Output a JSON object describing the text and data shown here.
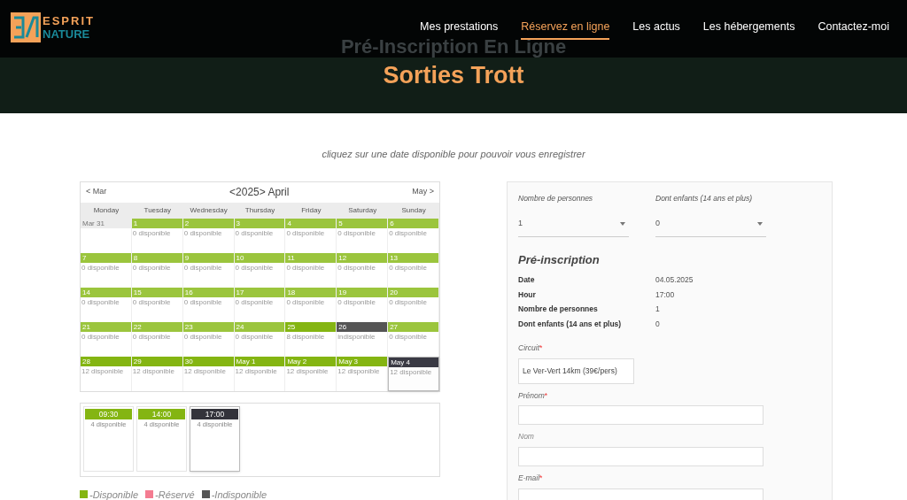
{
  "header": {
    "logo": {
      "line1": "ESPRIT",
      "line2": "NATURE"
    },
    "nav": [
      {
        "label": "Mes prestations",
        "selected": false
      },
      {
        "label": "Réservez en ligne",
        "selected": true
      },
      {
        "label": "Les actus",
        "selected": false
      },
      {
        "label": "Les hébergements",
        "selected": false
      },
      {
        "label": "Contactez-moi",
        "selected": false
      }
    ]
  },
  "hero": {
    "title": "Pré-Inscription En Ligne",
    "subtitle": "Sorties Trott"
  },
  "instruction": "cliquez sur une date disponible pour pouvoir vous enregistrer",
  "calendar": {
    "prev": "< Mar",
    "title": "<2025> April",
    "next": "May >",
    "weekdays": [
      "Monday",
      "Tuesday",
      "Wednesday",
      "Thursday",
      "Friday",
      "Saturday",
      "Sunday"
    ],
    "weeks": [
      [
        {
          "day": "Mar 31",
          "color": "#ececec",
          "selected": false
        },
        {
          "day": "1",
          "info": "0 disponible",
          "color": "#9bc53d",
          "selected": false
        },
        {
          "day": "2",
          "info": "0 disponible",
          "color": "#9bc53d",
          "selected": false
        },
        {
          "day": "3",
          "info": "0 disponible",
          "color": "#9bc53d",
          "selected": false
        },
        {
          "day": "4",
          "info": "0 disponible",
          "color": "#9bc53d",
          "selected": false
        },
        {
          "day": "5",
          "info": "0 disponible",
          "color": "#9bc53d",
          "selected": false
        },
        {
          "day": "6",
          "info": "0 disponible",
          "color": "#9bc53d",
          "selected": false
        }
      ],
      [
        {
          "day": "7",
          "info": "0 disponible",
          "color": "#9bc53d",
          "selected": false
        },
        {
          "day": "8",
          "info": "0 disponible",
          "color": "#9bc53d",
          "selected": false
        },
        {
          "day": "9",
          "info": "0 disponible",
          "color": "#9bc53d",
          "selected": false
        },
        {
          "day": "10",
          "info": "0 disponible",
          "color": "#9bc53d",
          "selected": false
        },
        {
          "day": "11",
          "info": "0 disponible",
          "color": "#9bc53d",
          "selected": false
        },
        {
          "day": "12",
          "info": "0 disponible",
          "color": "#9bc53d",
          "selected": false
        },
        {
          "day": "13",
          "info": "0 disponible",
          "color": "#9bc53d",
          "selected": false
        }
      ],
      [
        {
          "day": "14",
          "info": "0 disponible",
          "color": "#9bc53d",
          "selected": false
        },
        {
          "day": "15",
          "info": "0 disponible",
          "color": "#9bc53d",
          "selected": false
        },
        {
          "day": "16",
          "info": "0 disponible",
          "color": "#9bc53d",
          "selected": false
        },
        {
          "day": "17",
          "info": "0 disponible",
          "color": "#9bc53d",
          "selected": false
        },
        {
          "day": "18",
          "info": "0 disponible",
          "color": "#9bc53d",
          "selected": false
        },
        {
          "day": "19",
          "info": "0 disponible",
          "color": "#9bc53d",
          "selected": false
        },
        {
          "day": "20",
          "info": "0 disponible",
          "color": "#9bc53d",
          "selected": false
        }
      ],
      [
        {
          "day": "21",
          "info": "0 disponible",
          "color": "#9bc53d",
          "selected": false
        },
        {
          "day": "22",
          "info": "0 disponible",
          "color": "#9bc53d",
          "selected": false
        },
        {
          "day": "23",
          "info": "0 disponible",
          "color": "#9bc53d",
          "selected": false
        },
        {
          "day": "24",
          "info": "0 disponible",
          "color": "#9bc53d",
          "selected": false
        },
        {
          "day": "25",
          "info": "8 disponible",
          "color": "#84b512",
          "selected": false
        },
        {
          "day": "26",
          "info": "indisponible",
          "color": "#555555",
          "selected": false
        },
        {
          "day": "27",
          "info": "0 disponible",
          "color": "#9bc53d",
          "selected": false
        }
      ],
      [
        {
          "day": "28",
          "info": "12 disponible",
          "color": "#84b512",
          "selected": false
        },
        {
          "day": "29",
          "info": "12 disponible",
          "color": "#84b512",
          "selected": false
        },
        {
          "day": "30",
          "info": "12 disponible",
          "color": "#84b512",
          "selected": false
        },
        {
          "day": "May 1",
          "info": "12 disponible",
          "color": "#84b512",
          "selected": false
        },
        {
          "day": "May 2",
          "info": "12 disponible",
          "color": "#84b512",
          "selected": false
        },
        {
          "day": "May 3",
          "info": "12 disponible",
          "color": "#84b512",
          "selected": false
        },
        {
          "day": "May 4",
          "info": "12 disponible",
          "color": "#3a3a44",
          "selected": true
        }
      ]
    ]
  },
  "slots": [
    {
      "time": "09:30",
      "info": "4 disponible",
      "selected": false
    },
    {
      "time": "14:00",
      "info": "4 disponible",
      "selected": false
    },
    {
      "time": "17:00",
      "info": "4 disponible",
      "selected": true
    }
  ],
  "legend": [
    {
      "label": "-Disponible",
      "color": "#84b512"
    },
    {
      "label": "-Réservé",
      "color": "#f47c91"
    },
    {
      "label": "-Indisponible",
      "color": "#555555"
    }
  ],
  "form": {
    "selects": [
      {
        "label": "Nombre de personnes",
        "value": "1"
      },
      {
        "label": "Dont enfants (14 ans et plus)",
        "value": "0"
      }
    ],
    "heading": "Pré-inscription",
    "summary": [
      {
        "label": "Date",
        "value": "04.05.2025"
      },
      {
        "label": "Hour",
        "value": "17:00"
      },
      {
        "label": "Nombre de personnes",
        "value": "1"
      },
      {
        "label": "Dont enfants (14 ans et plus)",
        "value": "0"
      }
    ],
    "fields": [
      {
        "label": "Circuit",
        "required": true,
        "required_mark": "*",
        "kind": "select",
        "value": "Le Ver-Vert 14km (39€/pers)"
      },
      {
        "label": "Prénom",
        "required": true,
        "required_mark": "*",
        "kind": "text"
      },
      {
        "label": "Nom",
        "required": false,
        "kind": "text"
      },
      {
        "label": "E-mail",
        "required": true,
        "required_mark": "*",
        "kind": "text"
      }
    ]
  }
}
